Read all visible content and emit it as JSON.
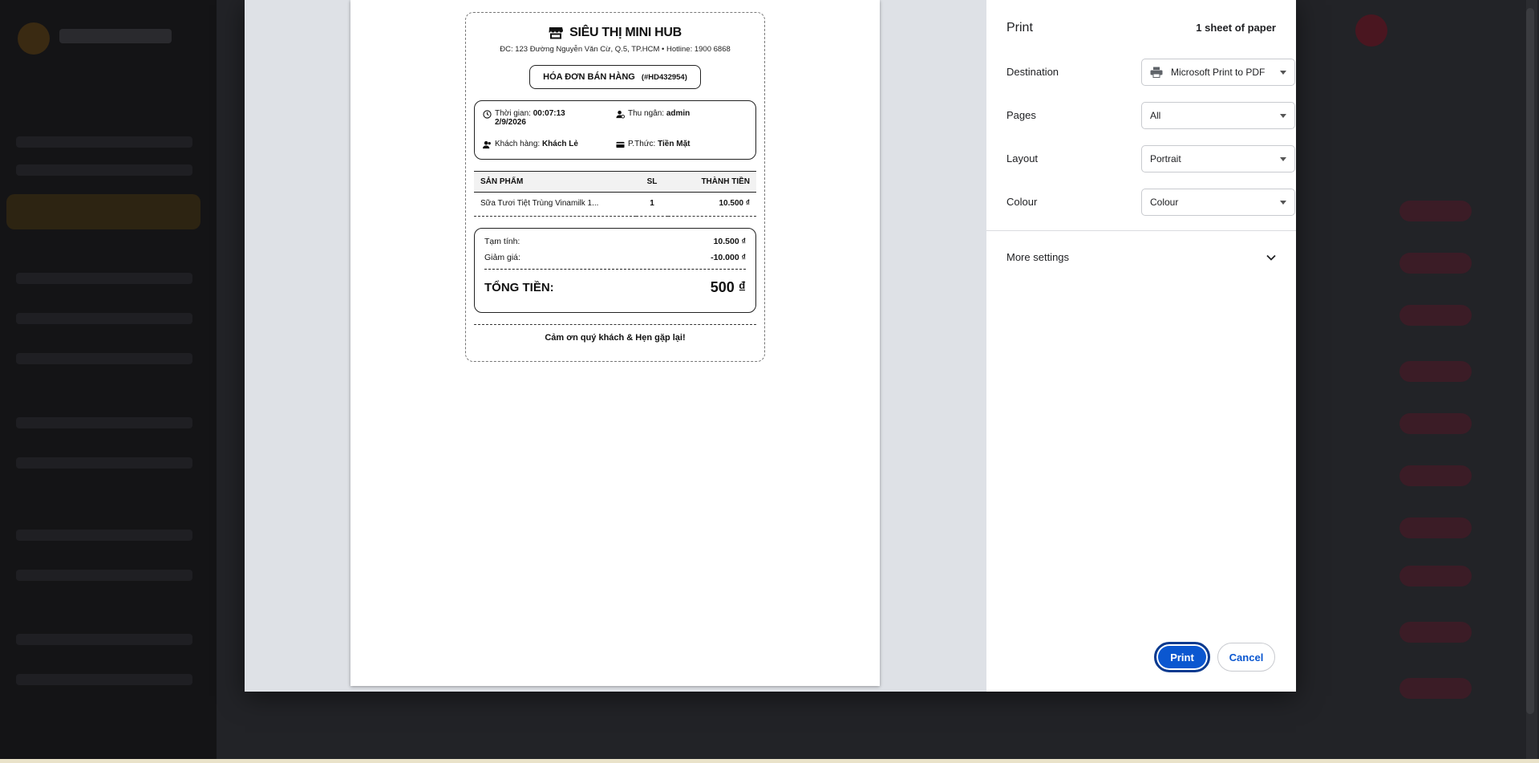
{
  "dialog": {
    "title": "Print",
    "sheet_count": "1 sheet of paper",
    "destination": {
      "label": "Destination",
      "value": "Microsoft Print to PDF"
    },
    "pages": {
      "label": "Pages",
      "value": "All"
    },
    "layout": {
      "label": "Layout",
      "value": "Portrait"
    },
    "colour": {
      "label": "Colour",
      "value": "Colour"
    },
    "more_settings": "More settings",
    "print_button": "Print",
    "cancel_button": "Cancel"
  },
  "receipt": {
    "store_name": "SIÊU THỊ MINI HUB",
    "address": "ĐC: 123 Đường Nguyễn Văn Cừ, Q.5, TP.HCM • Hotline: 1900 6868",
    "invoice_title": "HÓA ĐƠN BÁN HÀNG",
    "invoice_code": "(#HD432954)",
    "time_label": "Thời gian:",
    "time_value": "00:07:13",
    "date_value": "2/9/2026",
    "cashier_label": "Thu ngân:",
    "cashier_value": "admin",
    "customer_label": "Khách hàng:",
    "customer_value": "Khách Lẻ",
    "method_label": "P.Thức:",
    "method_value": "Tiền Mặt",
    "columns": {
      "product": "SẢN PHẨM",
      "qty": "SL",
      "amount": "THÀNH TIỀN"
    },
    "items": [
      {
        "name": "Sữa Tươi Tiệt Trùng Vinamilk 1...",
        "qty": "1",
        "amount": "10.500 ₫"
      }
    ],
    "subtotal_label": "Tạm tính:",
    "subtotal_value": "10.500 ₫",
    "discount_label": "Giảm giá:",
    "discount_value": "-10.000 ₫",
    "total_label": "TỔNG TIỀN:",
    "total_value": "500 ₫",
    "thanks": "Cảm ơn quý khách & Hẹn gặp lại!"
  }
}
